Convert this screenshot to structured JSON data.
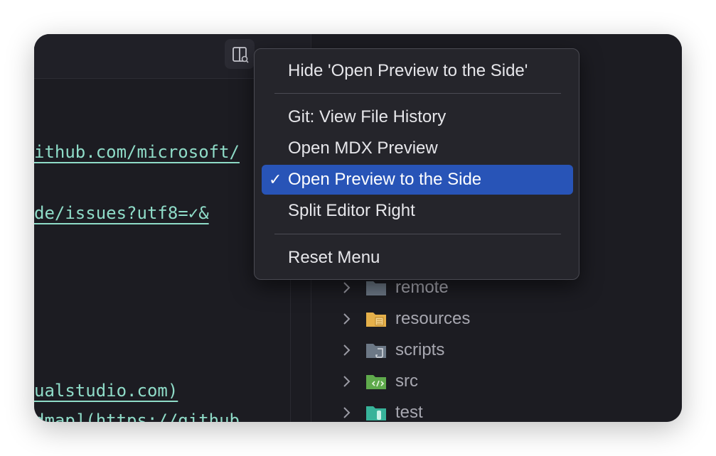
{
  "editor": {
    "lines": [
      "ithub.com/microsoft/",
      "de/issues?utf8=✓&",
      "ualstudio.com)",
      "dmap](https://github"
    ]
  },
  "context_menu": {
    "hide_item": "Hide 'Open Preview to the Side'",
    "items": [
      {
        "label": "Git: View File History",
        "checked": false
      },
      {
        "label": "Open MDX Preview",
        "checked": false
      },
      {
        "label": "Open Preview to the Side",
        "checked": true
      },
      {
        "label": "Split Editor Right",
        "checked": false
      }
    ],
    "checkmark": "✓",
    "reset_item": "Reset Menu"
  },
  "explorer": {
    "folders": [
      {
        "name": "remote",
        "icon": "folder-icon",
        "color": "#6c7886"
      },
      {
        "name": "resources",
        "icon": "resources-folder-icon",
        "color": "#e5b04a"
      },
      {
        "name": "scripts",
        "icon": "scripts-folder-icon",
        "color": "#6c7886"
      },
      {
        "name": "src",
        "icon": "src-folder-icon",
        "color": "#5faa4c"
      },
      {
        "name": "test",
        "icon": "test-folder-icon",
        "color": "#37b39a"
      }
    ]
  },
  "colors": {
    "accent": "#2854b7",
    "code_link": "#8fdcc8",
    "background": "#1c1c22"
  }
}
